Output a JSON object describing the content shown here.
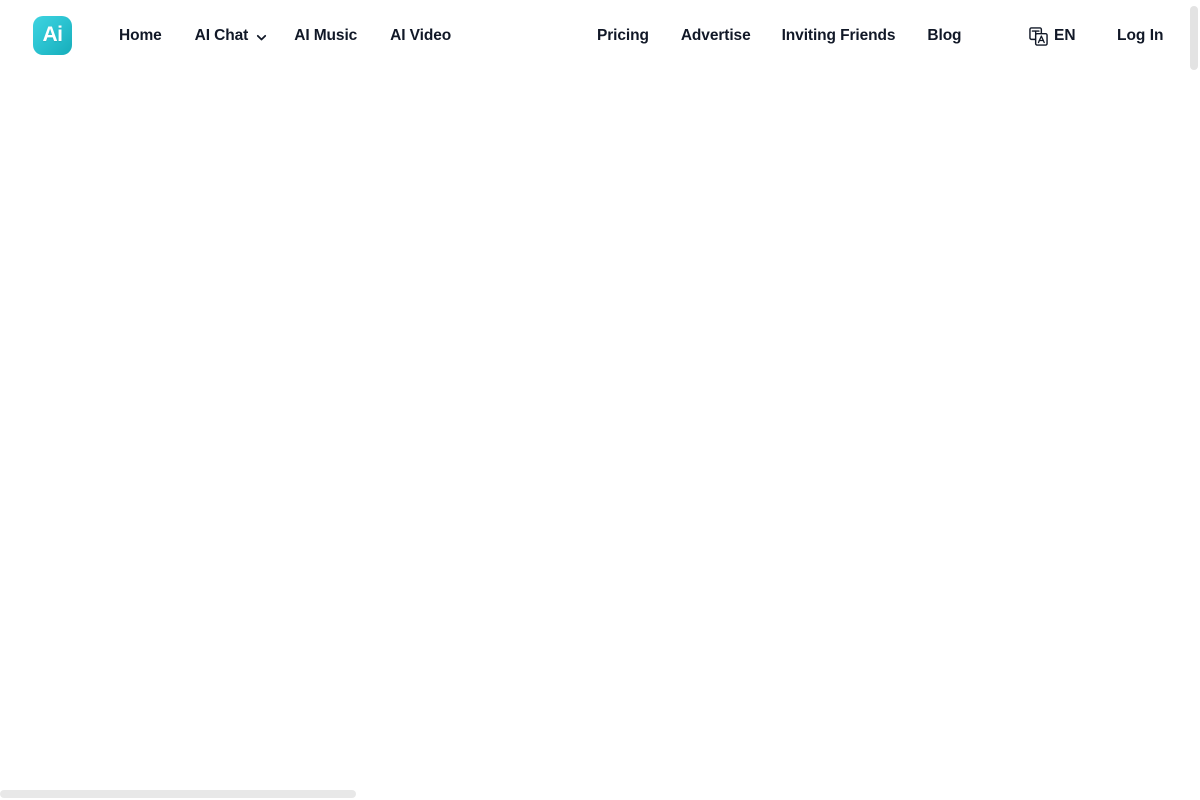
{
  "brand": {
    "logo_text": "Ai",
    "logo_icon": "ai-logo-icon",
    "gradient_from": "#3ed3e0",
    "gradient_to": "#16adba"
  },
  "nav_left": [
    {
      "label": "Home",
      "has_dropdown": false
    },
    {
      "label": "AI Chat",
      "has_dropdown": true,
      "dropdown_icon": "chevron-down-icon"
    },
    {
      "label": "AI Music",
      "has_dropdown": false
    },
    {
      "label": "AI Video",
      "has_dropdown": false
    }
  ],
  "nav_right": [
    {
      "label": "Pricing"
    },
    {
      "label": "Advertise"
    },
    {
      "label": "Inviting Friends"
    },
    {
      "label": "Blog"
    }
  ],
  "language": {
    "icon": "translate-icon",
    "code": "EN"
  },
  "account": {
    "login_label": "Log In"
  },
  "main": {
    "content": "",
    "state": "blank"
  },
  "scrollbars": {
    "vertical_visible": true,
    "horizontal_visible": true
  },
  "colors": {
    "text": "#111827",
    "background": "#ffffff",
    "accent": "#2ec6d4",
    "scrollbar_thumb": "#e3e3e3"
  }
}
